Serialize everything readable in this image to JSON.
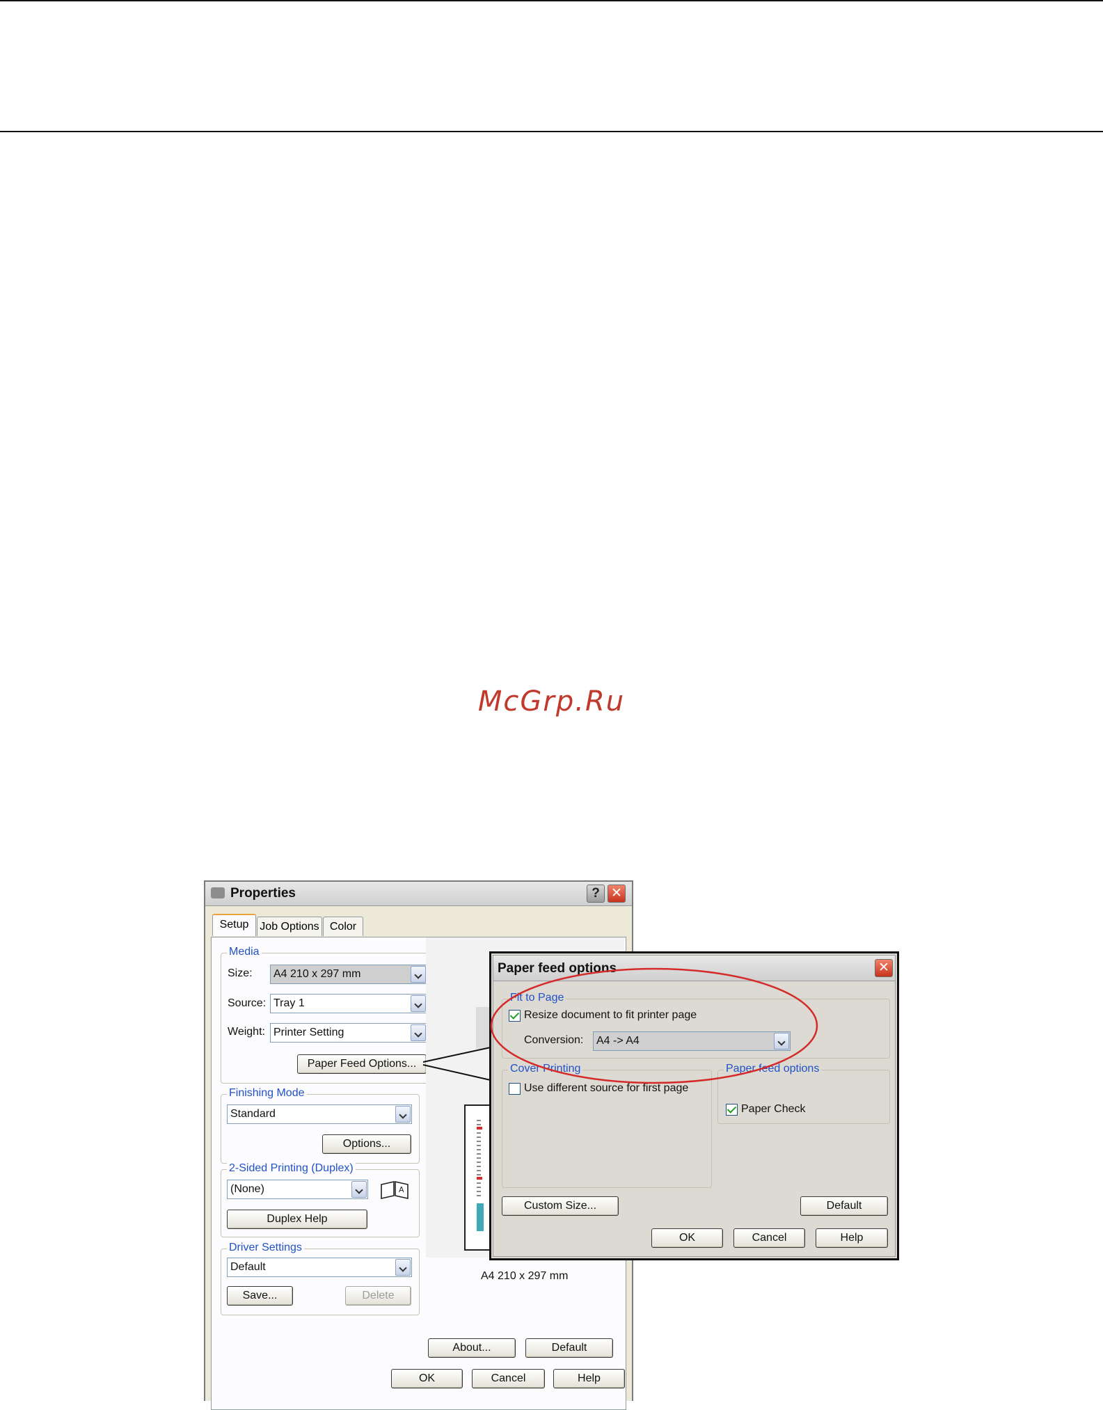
{
  "watermark": "McGrp.Ru",
  "properties": {
    "title": "Properties",
    "help_label": "?",
    "close_label": "✕",
    "tabs": [
      {
        "label": "Setup",
        "active": true
      },
      {
        "label": "Job Options",
        "active": false
      },
      {
        "label": "Color",
        "active": false
      }
    ],
    "media": {
      "legend": "Media",
      "size_label": "Size:",
      "size_value": "A4 210 x 297 mm",
      "source_label": "Source:",
      "source_value": "Tray 1",
      "weight_label": "Weight:",
      "weight_value": "Printer Setting",
      "paper_feed_button": "Paper Feed Options..."
    },
    "finishing": {
      "legend": "Finishing Mode",
      "value": "Standard",
      "options_button": "Options..."
    },
    "duplex": {
      "legend": "2-Sided Printing (Duplex)",
      "value": "(None)",
      "help_button": "Duplex Help"
    },
    "driver": {
      "legend": "Driver Settings",
      "value": "Default",
      "save_button": "Save...",
      "delete_button": "Delete"
    },
    "preview_caption": "A4 210 x 297 mm",
    "about_button": "About...",
    "default_button": "Default",
    "ok_button": "OK",
    "cancel_button": "Cancel",
    "help_button": "Help"
  },
  "paper_feed": {
    "title": "Paper feed options",
    "close_label": "✕",
    "fit_to_page": {
      "legend": "Fit to Page",
      "resize_label": "Resize document to fit printer page",
      "resize_checked": true,
      "conversion_label": "Conversion:",
      "conversion_value": "A4 -> A4"
    },
    "cover_printing": {
      "legend": "Cover Printing",
      "different_source_label": "Use different source for first page",
      "different_source_checked": false
    },
    "feed_options": {
      "legend": "Paper feed options",
      "paper_check_label": "Paper Check",
      "paper_check_checked": true
    },
    "custom_size_button": "Custom Size...",
    "default_button": "Default",
    "ok_button": "OK",
    "cancel_button": "Cancel",
    "help_button": "Help"
  },
  "colors": {
    "highlight_ring": "#d42a2a",
    "legend_text": "#2150c8",
    "watermark": "#c0392b"
  }
}
